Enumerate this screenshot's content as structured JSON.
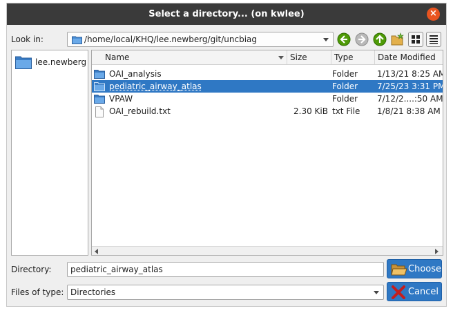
{
  "title": "Select a directory... (on kwlee)",
  "look_in": {
    "label": "Look in:",
    "value": "/home/local/KHQ/lee.newberg/git/uncbiag"
  },
  "toolbar": {
    "icons": [
      "back-icon",
      "forward-icon",
      "parent-directory-icon",
      "new-folder-icon",
      "list-view-icon",
      "detail-view-icon"
    ]
  },
  "sidebar": {
    "items": [
      {
        "label": "lee.newberg",
        "icon": "folder-icon"
      }
    ]
  },
  "file_list": {
    "columns": [
      "Name",
      "Size",
      "Type",
      "Date Modified"
    ],
    "rows": [
      {
        "name": "OAI_analysis",
        "size": "",
        "type": "Folder",
        "date": "1/13/21 8:25 AM",
        "icon": "folder-icon",
        "selected": false
      },
      {
        "name": "pediatric_airway_atlas",
        "size": "",
        "type": "Folder",
        "date": "7/25/23 3:31 PM",
        "icon": "folder-icon",
        "selected": true
      },
      {
        "name": "VPAW",
        "size": "",
        "type": "Folder",
        "date": "7/12/2....:50 AM",
        "icon": "folder-icon",
        "selected": false
      },
      {
        "name": "OAI_rebuild.txt",
        "size": "2.30 KiB",
        "type": "txt File",
        "date": "1/8/21 8:38 AM",
        "icon": "file-icon",
        "selected": false
      }
    ]
  },
  "directory": {
    "label": "Directory:",
    "value": "pediatric_airway_atlas"
  },
  "files_of_type": {
    "label": "Files of type:",
    "value": "Directories"
  },
  "buttons": {
    "choose": "Choose",
    "cancel": "Cancel"
  },
  "colors": {
    "titlebar": "#3a3a3a",
    "close": "#e95420",
    "selection": "#2f78c4",
    "folder": "#4a8fd6"
  }
}
